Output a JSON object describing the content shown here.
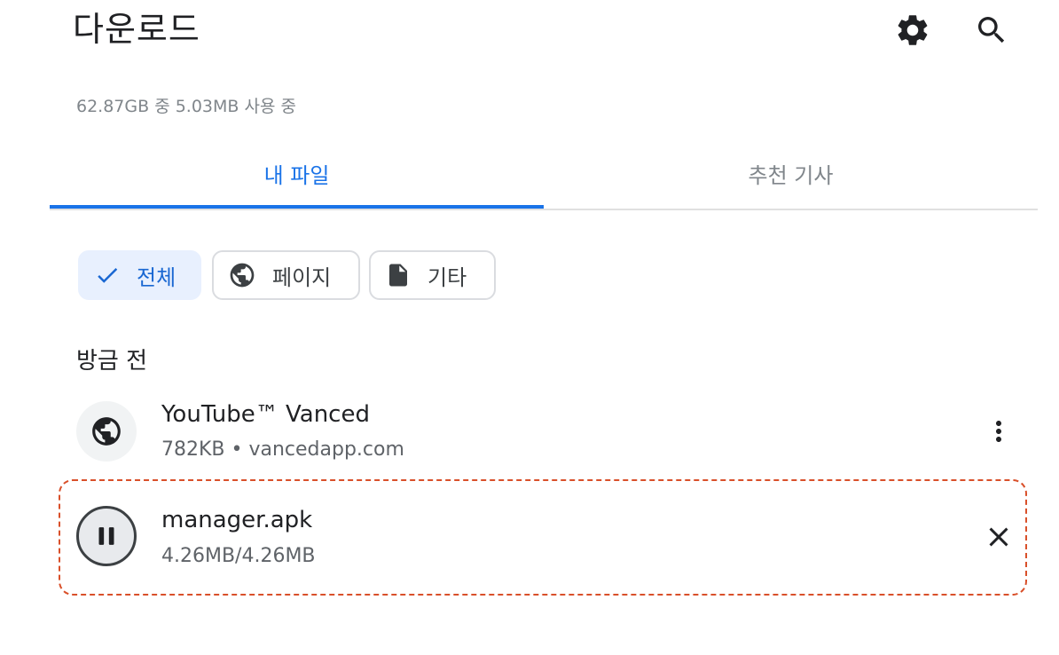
{
  "header": {
    "title": "다운로드",
    "settings_icon": "gear-icon",
    "search_icon": "search-icon"
  },
  "storage_text": "62.87GB 중 5.03MB 사용 중",
  "tabs": [
    {
      "label": "내 파일",
      "active": true
    },
    {
      "label": "추천 기사",
      "active": false
    }
  ],
  "filters": [
    {
      "label": "전체",
      "icon": "check-icon",
      "selected": true
    },
    {
      "label": "페이지",
      "icon": "globe-icon",
      "selected": false
    },
    {
      "label": "기타",
      "icon": "file-icon",
      "selected": false
    }
  ],
  "section_title": "방금 전",
  "downloads": [
    {
      "title": "YouTube™ Vanced",
      "subtitle": "782KB • vancedapp.com",
      "icon": "globe-icon",
      "action_icon": "more-vert-icon"
    },
    {
      "title": "manager.apk",
      "subtitle": "4.26MB/4.26MB",
      "icon": "pause-icon",
      "action_icon": "close-icon"
    }
  ],
  "colors": {
    "accent": "#1a73e8",
    "chip_selected_bg": "#e8f0fe",
    "highlight_border": "#d9502a"
  }
}
